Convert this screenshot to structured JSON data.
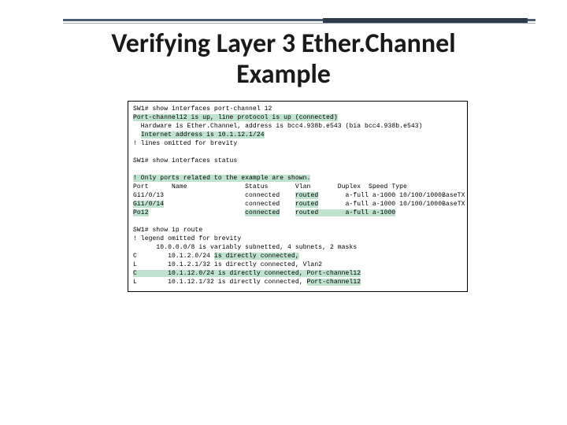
{
  "title": {
    "line1": "Verifying Layer 3 Ether.Channel",
    "line2": "Example"
  },
  "cli": {
    "l0": "SW1# show interfaces port-channel 12",
    "l1": "Port-channel12 is up, line protocol is up (connected)",
    "l2": "  Hardware is Ether.Channel, address is bcc4.938b.e543 (bia bcc4.938b.e543)",
    "l3": "Internet address is 10.1.12.1/24",
    "l4": "! lines omitted for brevity",
    "l5": "SW1# show interfaces status",
    "l6": "! Only ports related to the example are shown.",
    "l7": "Port      Name               Status       Vlan       Duplex  Speed Type",
    "l8a": "Gi1/0/13                     connected    ",
    "l8b": "routed",
    "l8c": "       a-full a-1000 10/100/1000BaseTX",
    "l9a": "Gi1/0/14",
    "l9b": "                     connected    ",
    "l9c": "routed",
    "l9d": "       a-full a-1000 10/100/1000BaseTX",
    "l10a": "Po12",
    "l10b": "                         ",
    "l10c": "connected",
    "l10d": "    ",
    "l10e": "routed       a-full a-1000",
    "l11": "SW1# show ip route",
    "l12": "! legend omitted for brevity",
    "l13": "      10.0.0.0/8 is variably subnetted, 4 subnets, 2 masks",
    "l14a": "C        10.1.2.0/24 ",
    "l14b": "is directly connected,",
    "l15": "L        10.1.2.1/32 is directly connected, Vlan2",
    "l16": "C        10.1.12.0/24 is directly connected, Port-channel12",
    "l17a": "L        10.1.12.1/32 is directly connected, ",
    "l17b": "Port-channel12"
  }
}
